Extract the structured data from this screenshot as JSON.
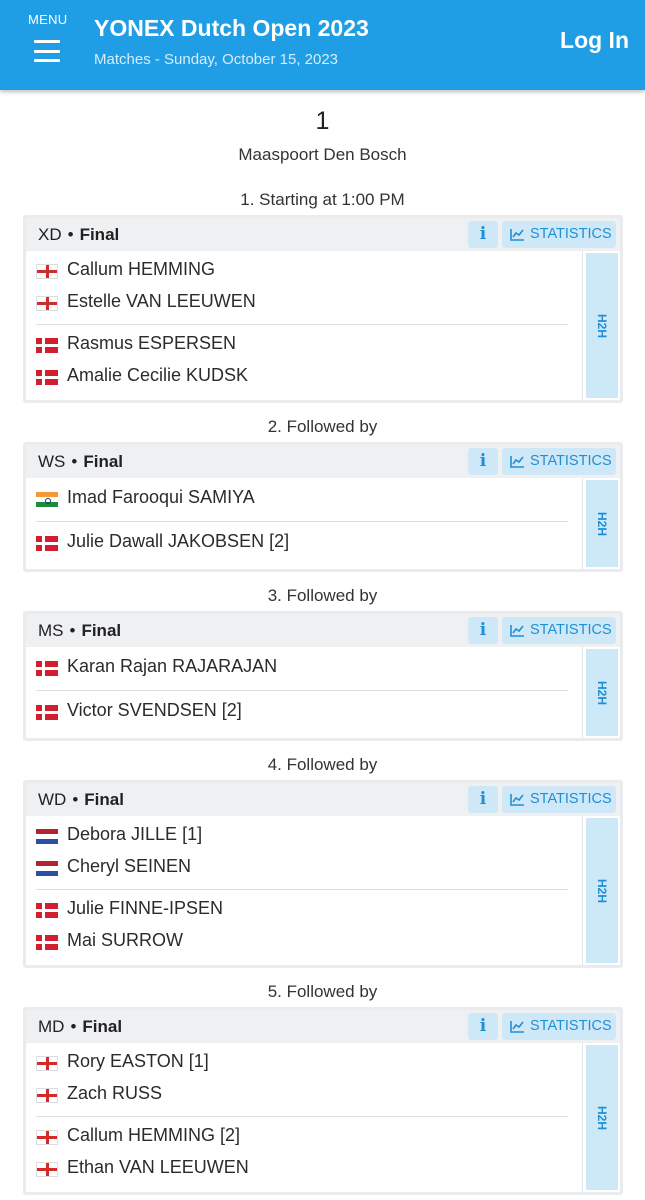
{
  "header": {
    "menu_label": "MENU",
    "title": "YONEX Dutch Open 2023",
    "subtitle": "Matches - Sunday, October 15, 2023",
    "login_label": "Log In"
  },
  "court": {
    "number": "1",
    "venue": "Maaspoort Den Bosch"
  },
  "colors": {
    "header_bg": "#1f9ee6",
    "accent": "#1f8fd6",
    "button_bg": "#cfe8f8"
  },
  "buttons": {
    "info_symbol": "i",
    "statistics_label": "STATISTICS",
    "h2h_label": "H2H"
  },
  "matches": [
    {
      "slot": "1. Starting at 1:00 PM",
      "event": "XD",
      "round": "Final",
      "team1": [
        {
          "flag": "england",
          "name": "Callum HEMMING"
        },
        {
          "flag": "england",
          "name": "Estelle VAN LEEUWEN"
        }
      ],
      "team2": [
        {
          "flag": "denmark",
          "name": "Rasmus ESPERSEN"
        },
        {
          "flag": "denmark",
          "name": "Amalie Cecilie KUDSK"
        }
      ]
    },
    {
      "slot": "2. Followed by",
      "event": "WS",
      "round": "Final",
      "team1": [
        {
          "flag": "india",
          "name": "Imad Farooqui SAMIYA"
        }
      ],
      "team2": [
        {
          "flag": "denmark",
          "name": "Julie Dawall JAKOBSEN [2]"
        }
      ]
    },
    {
      "slot": "3. Followed by",
      "event": "MS",
      "round": "Final",
      "team1": [
        {
          "flag": "denmark",
          "name": "Karan Rajan RAJARAJAN"
        }
      ],
      "team2": [
        {
          "flag": "denmark",
          "name": "Victor SVENDSEN [2]"
        }
      ]
    },
    {
      "slot": "4. Followed by",
      "event": "WD",
      "round": "Final",
      "team1": [
        {
          "flag": "netherlands",
          "name": "Debora JILLE [1]"
        },
        {
          "flag": "netherlands",
          "name": "Cheryl SEINEN"
        }
      ],
      "team2": [
        {
          "flag": "denmark",
          "name": "Julie FINNE-IPSEN"
        },
        {
          "flag": "denmark",
          "name": "Mai SURROW"
        }
      ]
    },
    {
      "slot": "5. Followed by",
      "event": "MD",
      "round": "Final",
      "team1": [
        {
          "flag": "england",
          "name": "Rory EASTON [1]"
        },
        {
          "flag": "england",
          "name": "Zach RUSS"
        }
      ],
      "team2": [
        {
          "flag": "england",
          "name": "Callum HEMMING [2]"
        },
        {
          "flag": "england",
          "name": "Ethan VAN LEEUWEN"
        }
      ]
    }
  ]
}
